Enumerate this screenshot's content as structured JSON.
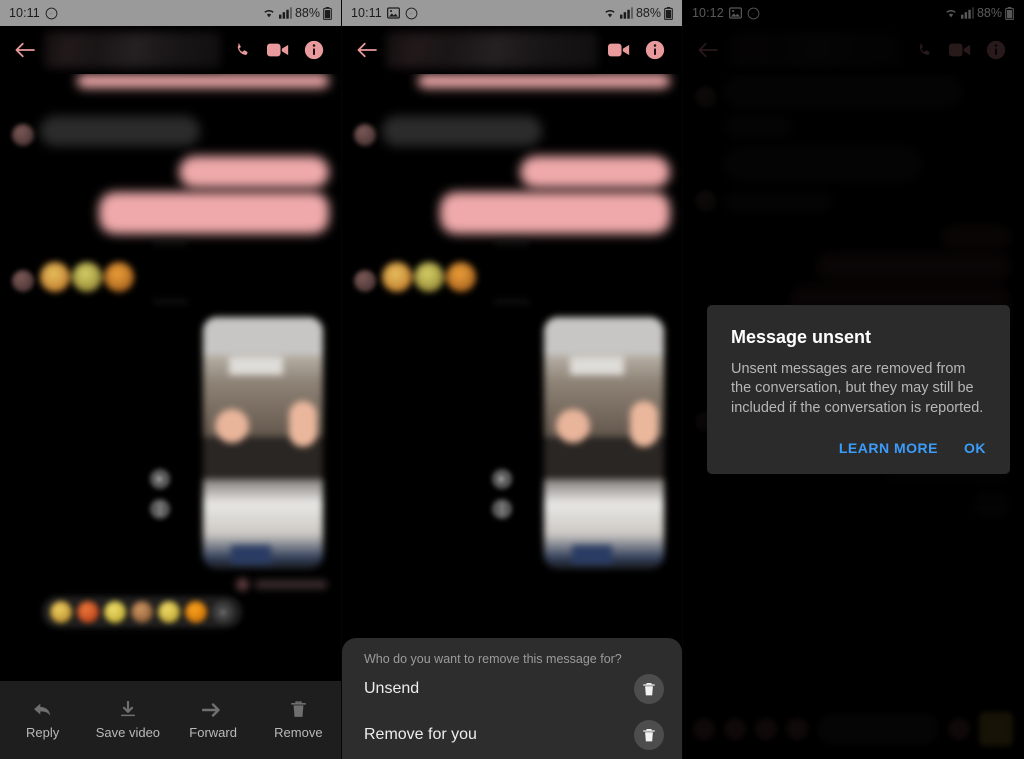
{
  "panels": [
    {
      "id": "panel-1-message-actions",
      "statusbar": {
        "time": "10:11",
        "battery": "88%",
        "style": "gray",
        "icons": [
          "messenger-icon",
          "wifi-icon",
          "signal-icon",
          "battery-icon"
        ]
      },
      "appbar": {
        "back": "back-arrow-icon",
        "actions": [
          "call-icon",
          "video-call-icon",
          "info-icon"
        ]
      },
      "action_bar": [
        {
          "label": "Reply",
          "icon": "reply-arrow-icon"
        },
        {
          "label": "Save video",
          "icon": "download-icon"
        },
        {
          "label": "Forward",
          "icon": "forward-arrow-icon"
        },
        {
          "label": "Remove",
          "icon": "trash-icon"
        }
      ]
    },
    {
      "id": "panel-2-remove-sheet",
      "statusbar": {
        "time": "10:11",
        "battery": "88%",
        "style": "gray",
        "icons": [
          "image-icon",
          "messenger-icon",
          "wifi-icon",
          "signal-icon",
          "battery-icon"
        ]
      },
      "appbar": {
        "back": "back-arrow-icon",
        "actions": [
          "video-call-icon",
          "info-icon"
        ]
      },
      "sheet": {
        "title": "Who do you want to remove this message for?",
        "options": [
          {
            "label": "Unsend",
            "icon": "trash-icon"
          },
          {
            "label": "Remove for you",
            "icon": "trash-icon"
          }
        ]
      }
    },
    {
      "id": "panel-3-message-unsent-dialog",
      "statusbar": {
        "time": "10:12",
        "battery": "88%",
        "style": "black",
        "icons": [
          "image-icon",
          "messenger-icon",
          "wifi-icon",
          "signal-icon",
          "battery-icon"
        ]
      },
      "appbar": {
        "back": "back-arrow-icon",
        "actions": [
          "call-icon",
          "video-call-icon",
          "info-icon"
        ]
      },
      "dialog": {
        "title": "Message unsent",
        "message": "Unsent messages are removed from the conversation, but they may still be included if the conversation is reported.",
        "buttons": [
          {
            "label": "LEARN MORE",
            "name": "learn-more-button"
          },
          {
            "label": "OK",
            "name": "ok-button"
          }
        ]
      }
    }
  ],
  "colors": {
    "outgoing_bubble": "#efa9aa",
    "incoming_bubble": "#2b2b2b",
    "accent_pink": "#e89a9c",
    "dialog_background": "#2b2b2b",
    "dialog_link": "#3b9dfb",
    "sheet_background": "#2d2d2d",
    "action_bar_background": "#1e1e1e",
    "status_bar_gray": "#9a9a9a"
  },
  "reaction_emojis": [
    "😍",
    "❤️",
    "😂",
    "😮",
    "😢",
    "😡"
  ],
  "reaction_add_label": "+"
}
